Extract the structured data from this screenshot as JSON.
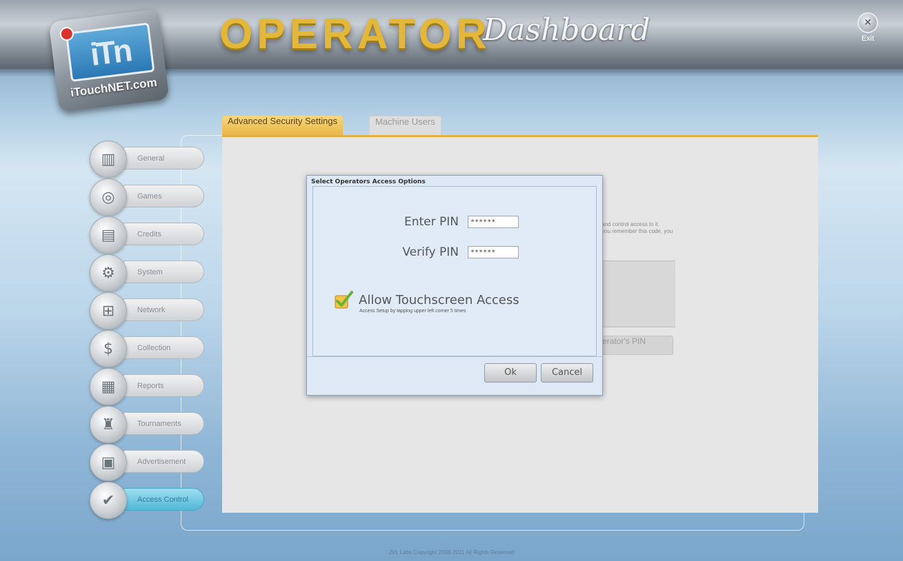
{
  "header": {
    "logo_text": "iTouchNET.com",
    "title_main": "OPERATOR",
    "title_sub": "Dashboard",
    "exit_label": "Exit"
  },
  "tabs": [
    {
      "label": "Advanced Security Settings",
      "active": true
    },
    {
      "label": "Machine Users",
      "active": false
    }
  ],
  "sidebar": {
    "items": [
      {
        "label": "General",
        "icon": "book-icon"
      },
      {
        "label": "Games",
        "icon": "game-disc-icon"
      },
      {
        "label": "Credits",
        "icon": "credits-icon"
      },
      {
        "label": "System",
        "icon": "monitor-gear-icon"
      },
      {
        "label": "Network",
        "icon": "network-icon"
      },
      {
        "label": "Collection",
        "icon": "dollar-icon"
      },
      {
        "label": "Reports",
        "icon": "report-icon"
      },
      {
        "label": "Tournaments",
        "icon": "trophy-icon"
      },
      {
        "label": "Advertisement",
        "icon": "advertisement-icon"
      },
      {
        "label": "Access Control",
        "icon": "keypad-check-icon",
        "active": true
      }
    ]
  },
  "background_panel": {
    "text_line1": "and control access to it.",
    "text_line2": "you remember this code, you",
    "button_label": "erator's PIN"
  },
  "dialog": {
    "title": "Select Operators Access Options",
    "pin_label": "Enter PIN",
    "pin_value": "******",
    "verify_label": "Verify PIN",
    "verify_value": "******",
    "allow_touch_label": "Allow Touchscreen Access",
    "allow_touch_hint": "Access Setup by tapping upper left corner 5 times",
    "allow_touch_checked": true,
    "ok_label": "Ok",
    "cancel_label": "Cancel"
  },
  "footer": {
    "copyright": "JVL Labs Copyright 2008-2011 All Rights Reserved"
  },
  "colors": {
    "accent_gold": "#e3b043",
    "active_sidebar": "#52b8d8"
  }
}
